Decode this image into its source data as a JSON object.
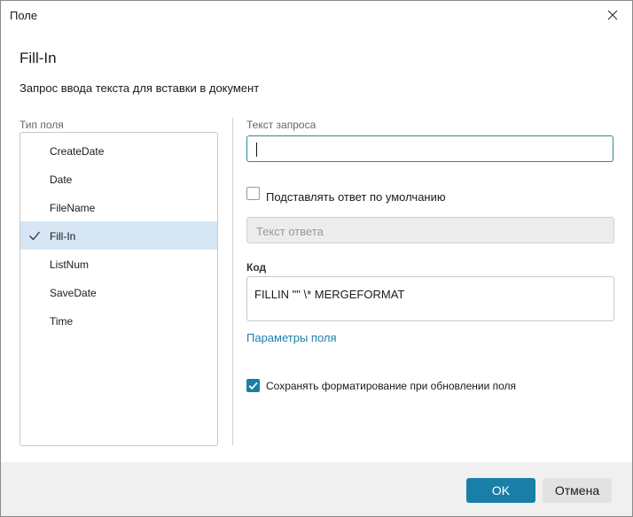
{
  "window": {
    "title": "Поле"
  },
  "heading": "Fill-In",
  "description": "Запрос ввода текста для вставки в документ",
  "field_types": {
    "label": "Тип поля",
    "items": [
      {
        "label": "CreateDate",
        "selected": false
      },
      {
        "label": "Date",
        "selected": false
      },
      {
        "label": "FileName",
        "selected": false
      },
      {
        "label": "Fill-In",
        "selected": true
      },
      {
        "label": "ListNum",
        "selected": false
      },
      {
        "label": "SaveDate",
        "selected": false
      },
      {
        "label": "Time",
        "selected": false
      }
    ]
  },
  "query": {
    "label": "Текст запроса",
    "value": ""
  },
  "default_answer": {
    "label": "Подставлять ответ по умолчанию",
    "checked": false,
    "placeholder": "Текст ответа"
  },
  "code": {
    "label": "Код",
    "value": "FILLIN \"\" \\* MERGEFORMAT"
  },
  "field_options_link": "Параметры поля",
  "keep_formatting": {
    "label": "Сохранять форматирование при обновлении поля",
    "checked": true
  },
  "buttons": {
    "ok": "OK",
    "cancel": "Отмена"
  },
  "colors": {
    "accent": "#1a7fa8",
    "selection": "#d6e6f5",
    "focus_border": "#2a8a92",
    "footer": "#f0f0f0"
  }
}
